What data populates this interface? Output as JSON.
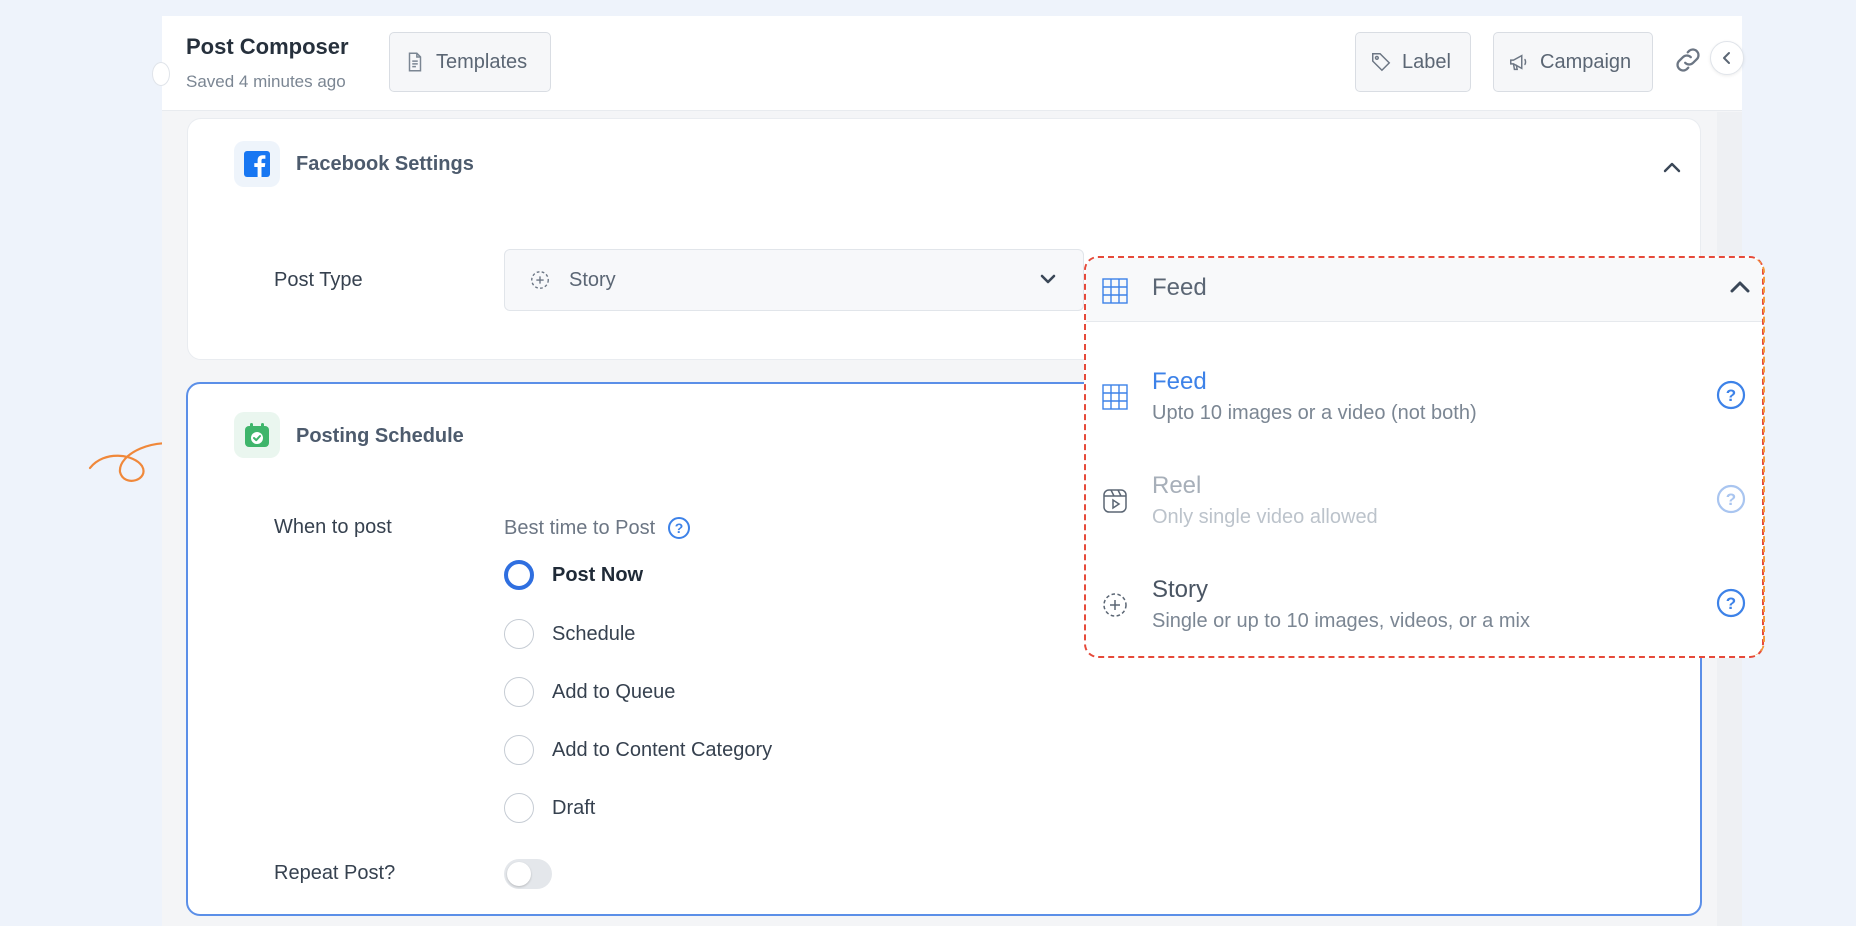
{
  "header": {
    "title": "Post Composer",
    "saved_status": "Saved 4 minutes ago",
    "templates_label": "Templates",
    "label_button": "Label",
    "campaign_button": "Campaign"
  },
  "facebook_settings": {
    "title": "Facebook Settings",
    "post_type_label": "Post Type",
    "selected_post_type": "Story"
  },
  "posting_schedule": {
    "title": "Posting Schedule",
    "when_label": "When to post",
    "best_time": "Best time to Post",
    "options": [
      "Post Now",
      "Schedule",
      "Add to Queue",
      "Add to Content Category",
      "Draft"
    ],
    "selected_option": "Post Now",
    "repeat_label": "Repeat Post?",
    "repeat_enabled": false
  },
  "post_type_dropdown": {
    "header_value": "Feed",
    "options": [
      {
        "title": "Feed",
        "subtitle": "Upto 10 images or a video (not both)",
        "icon": "grid-icon",
        "state": "active"
      },
      {
        "title": "Reel",
        "subtitle": "Only single video allowed",
        "icon": "reel-icon",
        "state": "disabled"
      },
      {
        "title": "Story",
        "subtitle": "Single or up to 10 images, videos, or a mix",
        "icon": "story-icon",
        "state": "normal"
      }
    ]
  },
  "colors": {
    "accent_blue": "#2f6fe0",
    "link_blue": "#3d82e8",
    "annotation_orange": "#f0883a",
    "annotation_red": "#e64a3a",
    "background": "#eef3fb"
  }
}
